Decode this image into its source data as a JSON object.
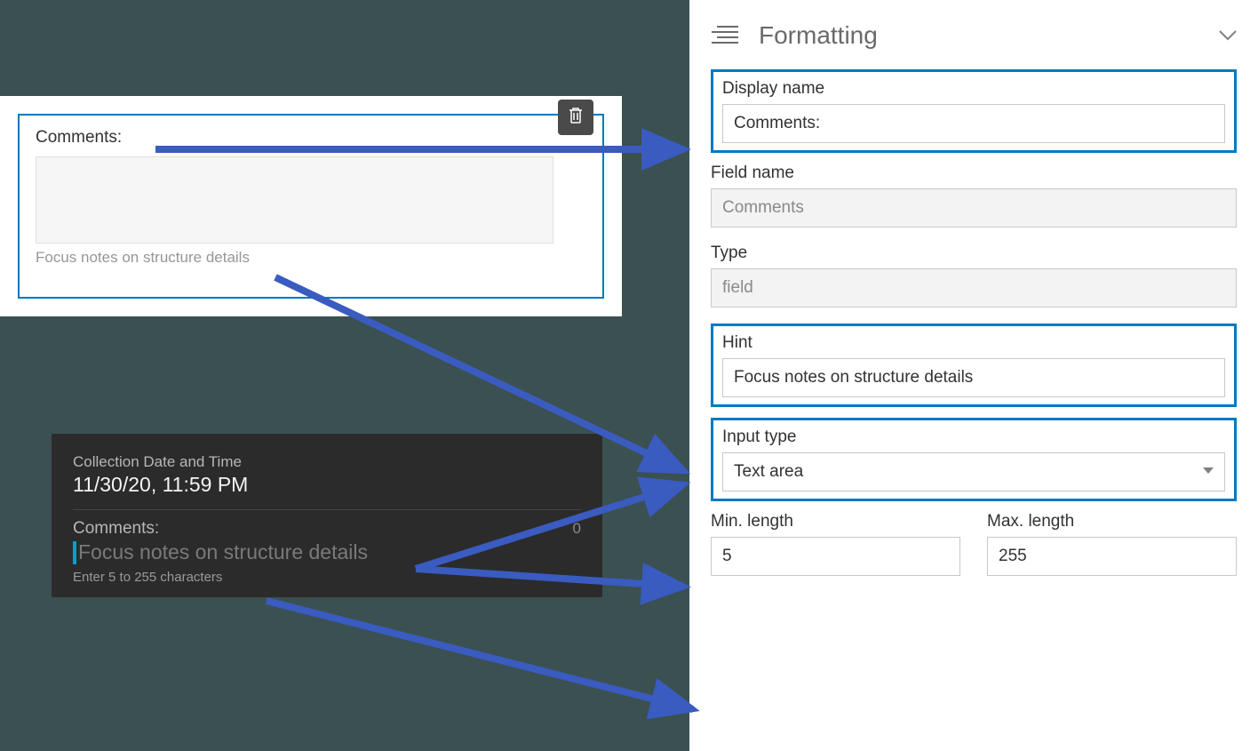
{
  "panel": {
    "title": "Formatting",
    "display_name": {
      "label": "Display name",
      "value": "Comments:"
    },
    "field_name": {
      "label": "Field name",
      "value": "Comments"
    },
    "type": {
      "label": "Type",
      "value": "field"
    },
    "hint": {
      "label": "Hint",
      "value": "Focus notes on structure details"
    },
    "input_type": {
      "label": "Input type",
      "value": "Text area"
    },
    "min_length": {
      "label": "Min. length",
      "value": "5"
    },
    "max_length": {
      "label": "Max. length",
      "value": "255"
    }
  },
  "form_preview": {
    "title": "Comments:",
    "hint": "Focus notes on structure details"
  },
  "dark_preview": {
    "datetime_label": "Collection Date and Time",
    "datetime_value": "11/30/20, 11:59 PM",
    "comments_label": "Comments:",
    "count": "0",
    "hint": "Focus notes on structure details",
    "range_hint": "Enter 5 to 255 characters"
  }
}
